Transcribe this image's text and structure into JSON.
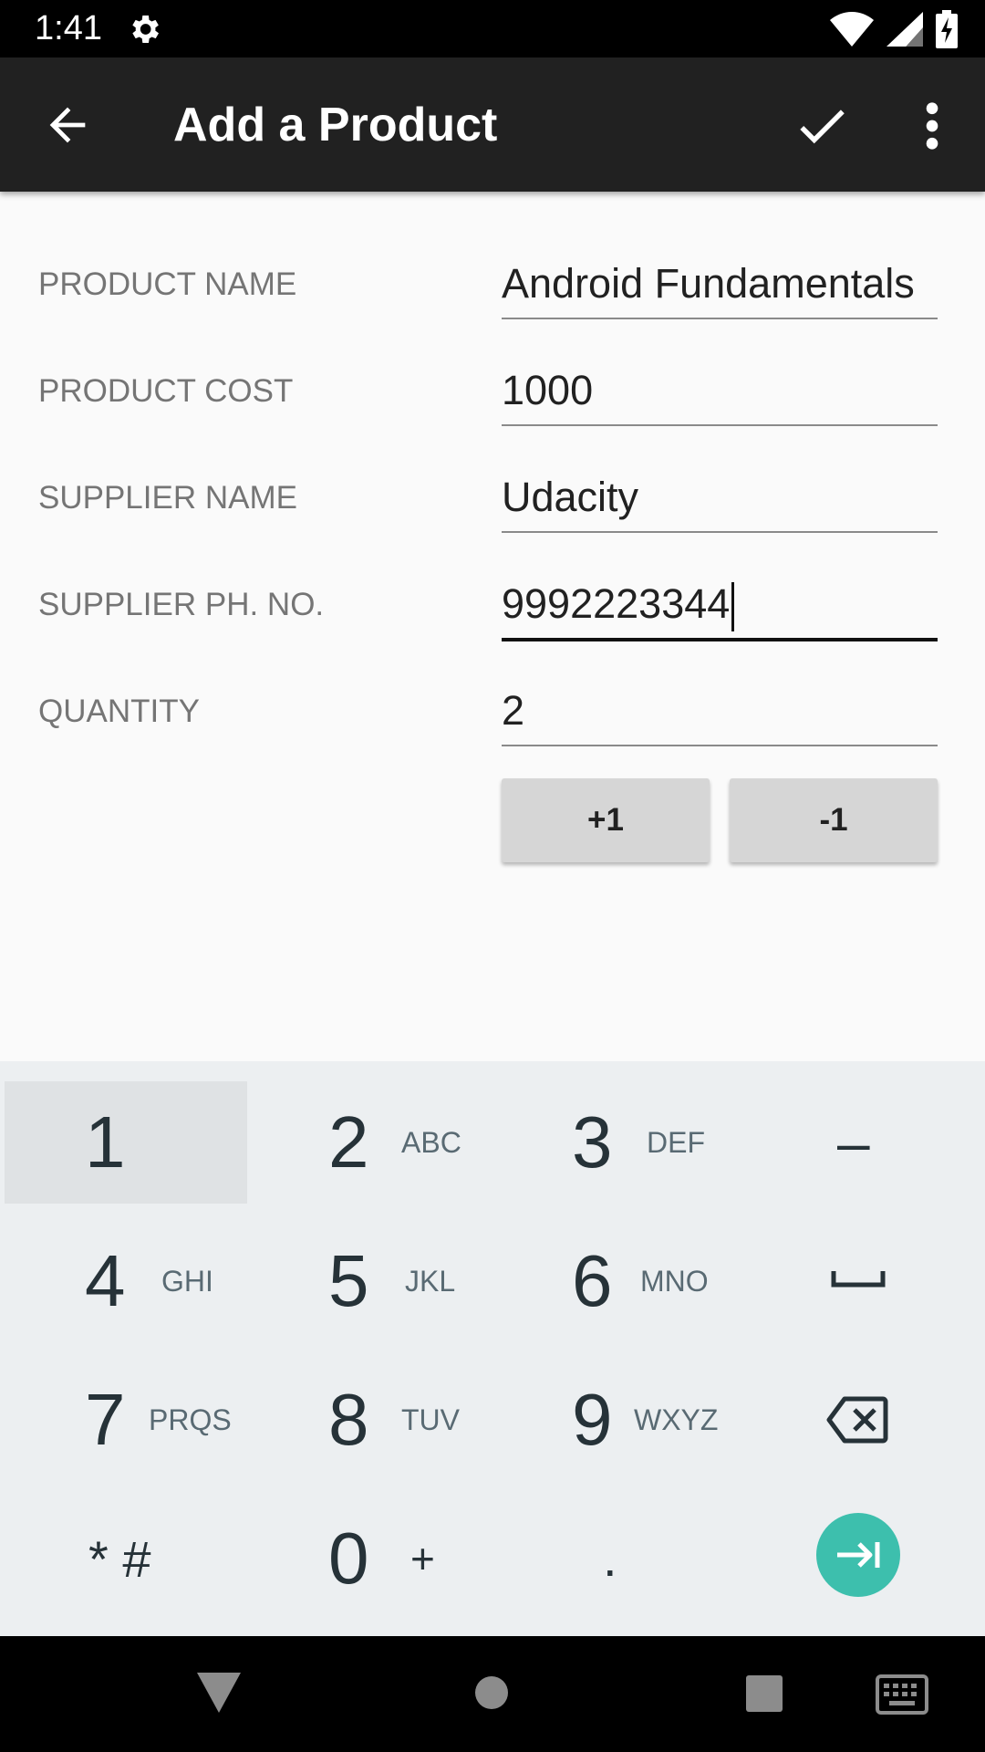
{
  "status_bar": {
    "time": "1:41"
  },
  "app_bar": {
    "title": "Add a Product"
  },
  "form": {
    "fields": [
      {
        "label": "PRODUCT NAME",
        "value": "Android Fundamentals"
      },
      {
        "label": "PRODUCT COST",
        "value": "1000"
      },
      {
        "label": "SUPPLIER NAME",
        "value": "Udacity"
      },
      {
        "label": "SUPPLIER PH. NO.",
        "value": "9992223344"
      },
      {
        "label": "QUANTITY",
        "value": "2"
      }
    ],
    "increment_label": "+1",
    "decrement_label": "-1"
  },
  "keyboard": {
    "keys": [
      {
        "digit": "1",
        "letters": ""
      },
      {
        "digit": "2",
        "letters": "ABC"
      },
      {
        "digit": "3",
        "letters": "DEF"
      },
      {
        "digit": "–",
        "letters": ""
      },
      {
        "digit": "4",
        "letters": "GHI"
      },
      {
        "digit": "5",
        "letters": "JKL"
      },
      {
        "digit": "6",
        "letters": "MNO"
      },
      {
        "digit": "7",
        "letters": "PRQS"
      },
      {
        "digit": "8",
        "letters": "TUV"
      },
      {
        "digit": "9",
        "letters": "WXYZ"
      },
      {
        "digit": "* #",
        "letters": ""
      },
      {
        "digit": "0",
        "letters": "+"
      },
      {
        "digit": ".",
        "letters": ""
      }
    ]
  },
  "colors": {
    "app_bar": "#212121",
    "keyboard_bg": "#eceff1",
    "enter_key": "#3dbfad"
  }
}
